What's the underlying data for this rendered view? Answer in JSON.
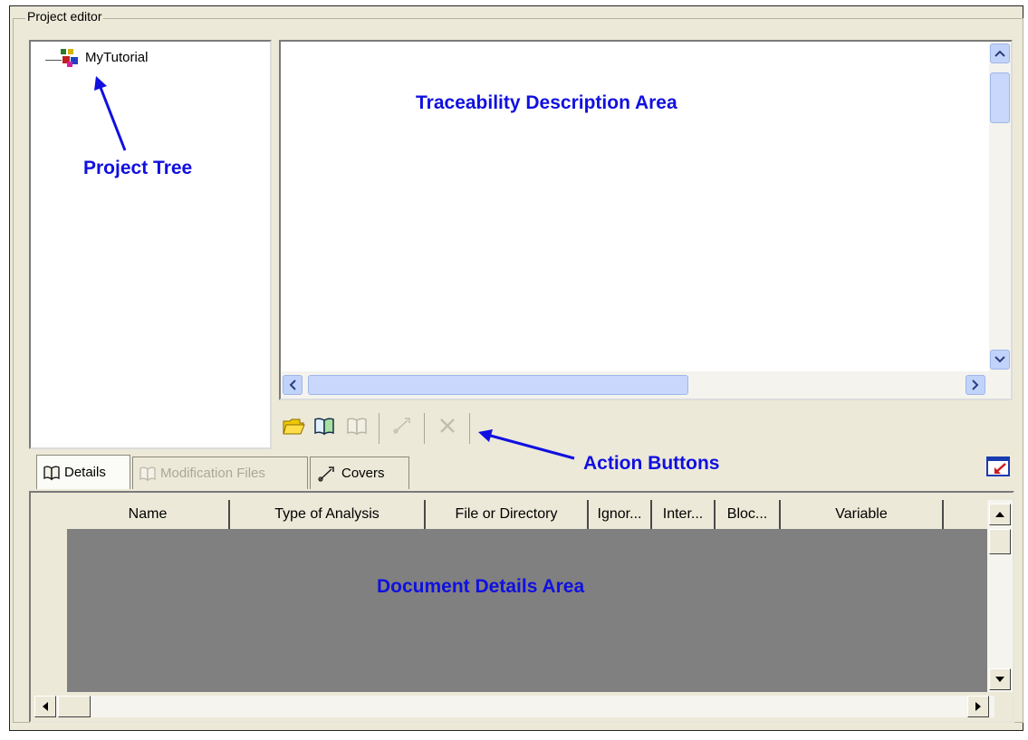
{
  "project_editor": {
    "label": "Project editor",
    "tree": {
      "root_label": "MyTutorial",
      "root_icon": "project-icon"
    },
    "annotations": {
      "project_tree": "Project Tree",
      "traceability_area": "Traceability Description Area",
      "action_buttons": "Action Buttons",
      "document_details": "Document Details Area"
    },
    "action_buttons": [
      {
        "icon": "open-folder-icon",
        "enabled": true
      },
      {
        "icon": "add-document-icon",
        "enabled": true
      },
      {
        "icon": "remove-document-icon",
        "enabled": false
      },
      {
        "icon": "link-icon",
        "enabled": false
      },
      {
        "icon": "delete-icon",
        "enabled": false
      }
    ],
    "tabs": [
      {
        "label": "Details",
        "icon": "book-icon",
        "enabled": true,
        "selected": true
      },
      {
        "label": "Modification Files",
        "icon": "book-icon",
        "enabled": false,
        "selected": false
      },
      {
        "label": "Covers",
        "icon": "link-icon",
        "enabled": true,
        "selected": false
      }
    ],
    "columns": [
      "Name",
      "Type of Analysis",
      "File or Directory",
      "Ignor...",
      "Inter...",
      "Bloc...",
      "Variable"
    ],
    "colors": {
      "annotation": "#1010e0",
      "panel_bg": "#ece9d8",
      "grid_bg": "#808080"
    }
  }
}
